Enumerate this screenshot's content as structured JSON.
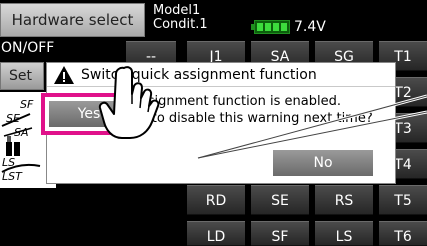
{
  "header": {
    "hardware_select_label": "Hardware select",
    "model_name": "Model1",
    "condition": "Condit.1",
    "voltage": "7.4V"
  },
  "left": {
    "on_off": "ON/OFF",
    "set_label": "Set",
    "switch_labels": [
      "SF",
      "SE",
      "SA",
      "LS",
      "LST"
    ]
  },
  "grid": {
    "row1": [
      "J1",
      "SA",
      "SG",
      "T1"
    ],
    "row1_partial": "--",
    "row2": [
      "T2"
    ],
    "row3": [
      "T3"
    ],
    "row4": [
      "T4"
    ],
    "row5": [
      "RD",
      "SE",
      "RS",
      "T5"
    ],
    "row6": [
      "LD",
      "SF",
      "LS",
      "T6"
    ]
  },
  "dialog": {
    "title": "Switch quick assignment function",
    "line1": "Switch quick assignment function is enabled.",
    "line2": "Would you like to disable this warning next time?",
    "yes_label": "Yes",
    "no_label": "No"
  },
  "colors": {
    "highlight": "#e0118a",
    "battery": "#3ddc3d"
  }
}
